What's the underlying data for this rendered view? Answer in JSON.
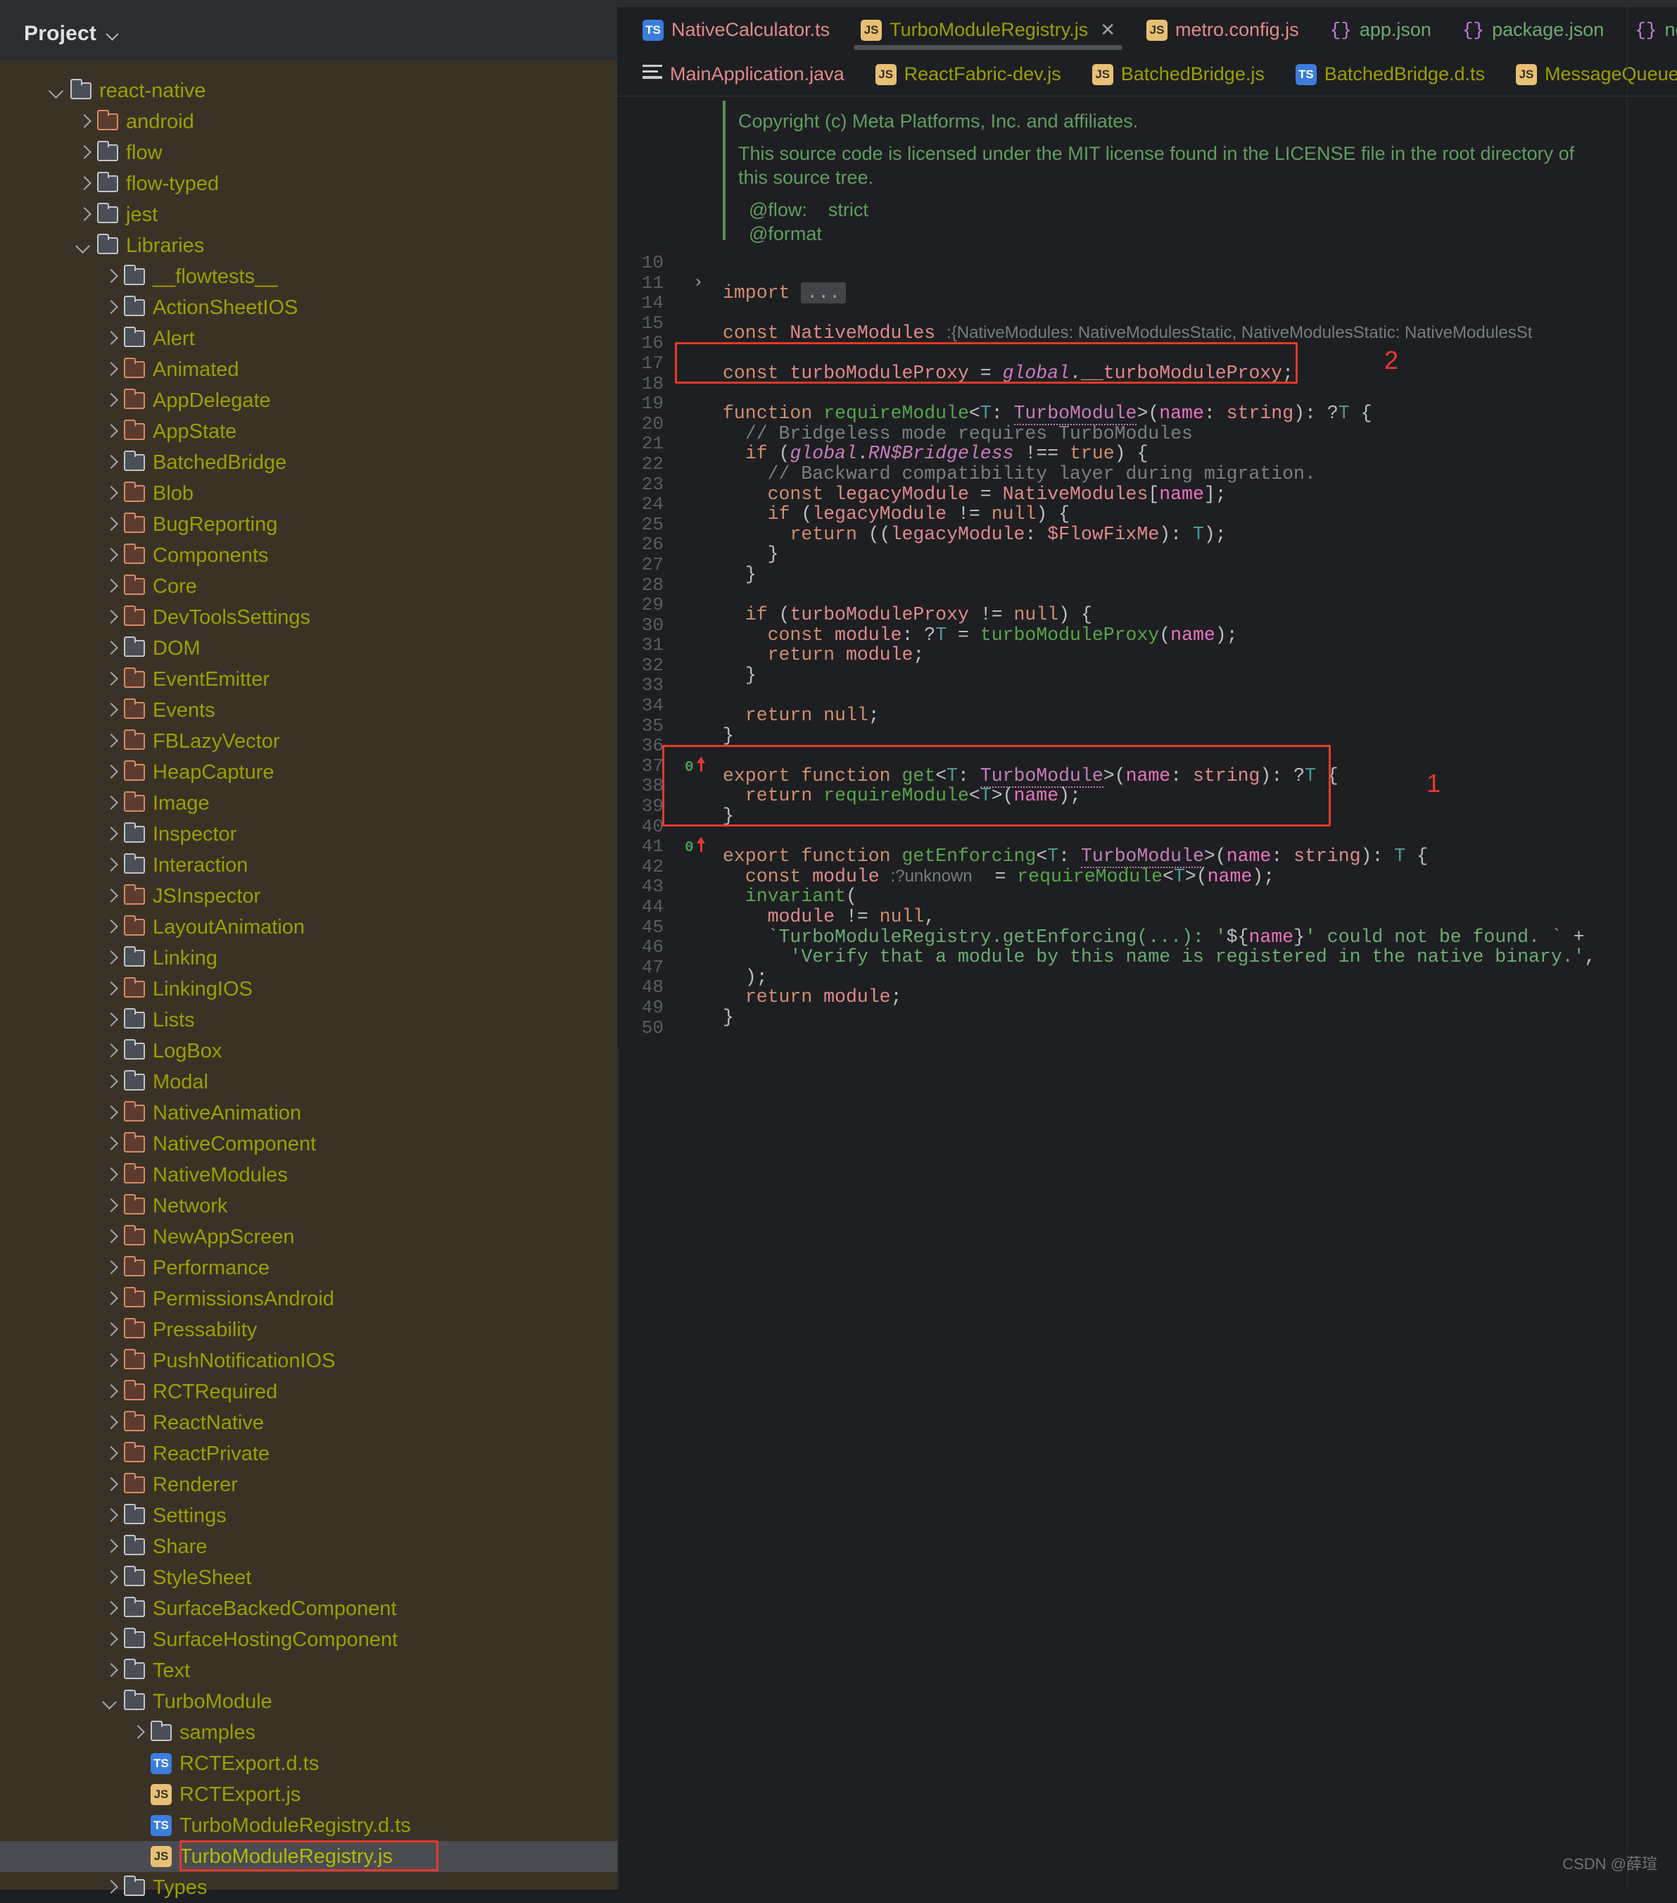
{
  "app": {
    "sidebar_title": "Project",
    "watermark": "CSDN @薛瑄"
  },
  "tabs_row1": [
    {
      "label": "NativeCalculator.ts",
      "icon": "ts-badge",
      "color": "#e08a8a",
      "active": false,
      "closable": false
    },
    {
      "label": "TurboModuleRegistry.js",
      "icon": "js-badge",
      "color": "#9aa000",
      "active": true,
      "closable": true,
      "close": "✕"
    },
    {
      "label": "metro.config.js",
      "icon": "js-badge",
      "color": "#e08a8a",
      "active": false,
      "closable": false
    },
    {
      "label": "app.json",
      "icon": "json-braces",
      "color": "#6aab73",
      "active": false,
      "closable": false
    },
    {
      "label": "package.json",
      "icon": "json-braces",
      "color": "#6aab73",
      "active": false,
      "closable": false
    },
    {
      "label": "node_m",
      "icon": "json-braces",
      "color": "#6aab73",
      "active": false,
      "closable": false
    }
  ],
  "tabs_row2": [
    {
      "label": "MainApplication.java",
      "icon": "java-lines",
      "color": "#e08a8a"
    },
    {
      "label": "ReactFabric-dev.js",
      "icon": "js-badge",
      "color": "#9aa000"
    },
    {
      "label": "BatchedBridge.js",
      "icon": "js-badge",
      "color": "#9aa000"
    },
    {
      "label": "BatchedBridge.d.ts",
      "icon": "ts-badge",
      "color": "#9aa000"
    },
    {
      "label": "MessageQueue.js",
      "icon": "js-badge",
      "color": "#9aa000"
    }
  ],
  "tree": [
    {
      "label": "react-native",
      "type": "folder",
      "indent": 1,
      "state": "open",
      "mod": false
    },
    {
      "label": "android",
      "type": "folder",
      "indent": 2,
      "state": "closed",
      "mod": true
    },
    {
      "label": "flow",
      "type": "folder",
      "indent": 2,
      "state": "closed",
      "mod": false
    },
    {
      "label": "flow-typed",
      "type": "folder",
      "indent": 2,
      "state": "closed",
      "mod": false
    },
    {
      "label": "jest",
      "type": "folder",
      "indent": 2,
      "state": "closed",
      "mod": false
    },
    {
      "label": "Libraries",
      "type": "folder",
      "indent": 2,
      "state": "open",
      "mod": false
    },
    {
      "label": "__flowtests__",
      "type": "folder",
      "indent": 3,
      "state": "closed",
      "mod": false
    },
    {
      "label": "ActionSheetIOS",
      "type": "folder",
      "indent": 3,
      "state": "closed",
      "mod": false
    },
    {
      "label": "Alert",
      "type": "folder",
      "indent": 3,
      "state": "closed",
      "mod": false
    },
    {
      "label": "Animated",
      "type": "folder",
      "indent": 3,
      "state": "closed",
      "mod": true
    },
    {
      "label": "AppDelegate",
      "type": "folder",
      "indent": 3,
      "state": "closed",
      "mod": true
    },
    {
      "label": "AppState",
      "type": "folder",
      "indent": 3,
      "state": "closed",
      "mod": true
    },
    {
      "label": "BatchedBridge",
      "type": "folder",
      "indent": 3,
      "state": "closed",
      "mod": false
    },
    {
      "label": "Blob",
      "type": "folder",
      "indent": 3,
      "state": "closed",
      "mod": true
    },
    {
      "label": "BugReporting",
      "type": "folder",
      "indent": 3,
      "state": "closed",
      "mod": true
    },
    {
      "label": "Components",
      "type": "folder",
      "indent": 3,
      "state": "closed",
      "mod": true
    },
    {
      "label": "Core",
      "type": "folder",
      "indent": 3,
      "state": "closed",
      "mod": true
    },
    {
      "label": "DevToolsSettings",
      "type": "folder",
      "indent": 3,
      "state": "closed",
      "mod": true
    },
    {
      "label": "DOM",
      "type": "folder",
      "indent": 3,
      "state": "closed",
      "mod": false
    },
    {
      "label": "EventEmitter",
      "type": "folder",
      "indent": 3,
      "state": "closed",
      "mod": true
    },
    {
      "label": "Events",
      "type": "folder",
      "indent": 3,
      "state": "closed",
      "mod": true
    },
    {
      "label": "FBLazyVector",
      "type": "folder",
      "indent": 3,
      "state": "closed",
      "mod": true
    },
    {
      "label": "HeapCapture",
      "type": "folder",
      "indent": 3,
      "state": "closed",
      "mod": true
    },
    {
      "label": "Image",
      "type": "folder",
      "indent": 3,
      "state": "closed",
      "mod": true
    },
    {
      "label": "Inspector",
      "type": "folder",
      "indent": 3,
      "state": "closed",
      "mod": false
    },
    {
      "label": "Interaction",
      "type": "folder",
      "indent": 3,
      "state": "closed",
      "mod": false
    },
    {
      "label": "JSInspector",
      "type": "folder",
      "indent": 3,
      "state": "closed",
      "mod": true
    },
    {
      "label": "LayoutAnimation",
      "type": "folder",
      "indent": 3,
      "state": "closed",
      "mod": true
    },
    {
      "label": "Linking",
      "type": "folder",
      "indent": 3,
      "state": "closed",
      "mod": false
    },
    {
      "label": "LinkingIOS",
      "type": "folder",
      "indent": 3,
      "state": "closed",
      "mod": true
    },
    {
      "label": "Lists",
      "type": "folder",
      "indent": 3,
      "state": "closed",
      "mod": false
    },
    {
      "label": "LogBox",
      "type": "folder",
      "indent": 3,
      "state": "closed",
      "mod": false
    },
    {
      "label": "Modal",
      "type": "folder",
      "indent": 3,
      "state": "closed",
      "mod": false
    },
    {
      "label": "NativeAnimation",
      "type": "folder",
      "indent": 3,
      "state": "closed",
      "mod": true
    },
    {
      "label": "NativeComponent",
      "type": "folder",
      "indent": 3,
      "state": "closed",
      "mod": true
    },
    {
      "label": "NativeModules",
      "type": "folder",
      "indent": 3,
      "state": "closed",
      "mod": true
    },
    {
      "label": "Network",
      "type": "folder",
      "indent": 3,
      "state": "closed",
      "mod": true
    },
    {
      "label": "NewAppScreen",
      "type": "folder",
      "indent": 3,
      "state": "closed",
      "mod": true
    },
    {
      "label": "Performance",
      "type": "folder",
      "indent": 3,
      "state": "closed",
      "mod": true
    },
    {
      "label": "PermissionsAndroid",
      "type": "folder",
      "indent": 3,
      "state": "closed",
      "mod": true
    },
    {
      "label": "Pressability",
      "type": "folder",
      "indent": 3,
      "state": "closed",
      "mod": true
    },
    {
      "label": "PushNotificationIOS",
      "type": "folder",
      "indent": 3,
      "state": "closed",
      "mod": true
    },
    {
      "label": "RCTRequired",
      "type": "folder",
      "indent": 3,
      "state": "closed",
      "mod": true
    },
    {
      "label": "ReactNative",
      "type": "folder",
      "indent": 3,
      "state": "closed",
      "mod": true
    },
    {
      "label": "ReactPrivate",
      "type": "folder",
      "indent": 3,
      "state": "closed",
      "mod": true
    },
    {
      "label": "Renderer",
      "type": "folder",
      "indent": 3,
      "state": "closed",
      "mod": true
    },
    {
      "label": "Settings",
      "type": "folder",
      "indent": 3,
      "state": "closed",
      "mod": false
    },
    {
      "label": "Share",
      "type": "folder",
      "indent": 3,
      "state": "closed",
      "mod": false
    },
    {
      "label": "StyleSheet",
      "type": "folder",
      "indent": 3,
      "state": "closed",
      "mod": false
    },
    {
      "label": "SurfaceBackedComponent",
      "type": "folder",
      "indent": 3,
      "state": "closed",
      "mod": false
    },
    {
      "label": "SurfaceHostingComponent",
      "type": "folder",
      "indent": 3,
      "state": "closed",
      "mod": false
    },
    {
      "label": "Text",
      "type": "folder",
      "indent": 3,
      "state": "closed",
      "mod": false
    },
    {
      "label": "TurboModule",
      "type": "folder",
      "indent": 3,
      "state": "open",
      "mod": false
    },
    {
      "label": "samples",
      "type": "folder",
      "indent": 4,
      "state": "closed",
      "mod": false
    },
    {
      "label": "RCTExport.d.ts",
      "type": "file",
      "indent": 4,
      "icon": "ts",
      "state": "none"
    },
    {
      "label": "RCTExport.js",
      "type": "file",
      "indent": 4,
      "icon": "js",
      "state": "none"
    },
    {
      "label": "TurboModuleRegistry.d.ts",
      "type": "file",
      "indent": 4,
      "icon": "ts",
      "state": "none"
    },
    {
      "label": "TurboModuleRegistry.js",
      "type": "file",
      "indent": 4,
      "icon": "js",
      "state": "none",
      "selected": true,
      "boxed": true
    },
    {
      "label": "Types",
      "type": "folder",
      "indent": 3,
      "state": "closed",
      "mod": false
    }
  ],
  "doc_comment": [
    "Copyright (c) Meta Platforms, Inc. and affiliates.",
    "This source code is licensed under the MIT license found in the LICENSE file in the root directory of",
    "this source tree.",
    "@flow:    strict",
    "@format"
  ],
  "line_numbers": [
    "10",
    "11",
    "14",
    "15",
    "16",
    "17",
    "18",
    "19",
    "20",
    "21",
    "22",
    "23",
    "24",
    "25",
    "26",
    "27",
    "28",
    "29",
    "30",
    "31",
    "32",
    "33",
    "34",
    "35",
    "36",
    "37",
    "38",
    "39",
    "40",
    "41",
    "42",
    "43",
    "44",
    "45",
    "46",
    "47",
    "48",
    "49",
    "50"
  ],
  "code_lines": [
    {
      "n": "10",
      "text": ""
    },
    {
      "n": "11",
      "text": "import ...",
      "folded": true
    },
    {
      "n": "14",
      "text": ""
    },
    {
      "n": "15",
      "text": "const NativeModules :{NativeModules: NativeModulesStatic, NativeModulesStatic: NativeModulesSt"
    },
    {
      "n": "16",
      "text": ""
    },
    {
      "n": "17",
      "text": "const turboModuleProxy = global.__turboModuleProxy;"
    },
    {
      "n": "18",
      "text": ""
    },
    {
      "n": "19",
      "text": "function requireModule<T: TurboModule>(name: string): ?T {"
    },
    {
      "n": "20",
      "text": "  // Bridgeless mode requires TurboModules"
    },
    {
      "n": "21",
      "text": "  if (global.RN$Bridgeless !== true) {"
    },
    {
      "n": "22",
      "text": "    // Backward compatibility layer during migration."
    },
    {
      "n": "23",
      "text": "    const legacyModule = NativeModules[name];"
    },
    {
      "n": "24",
      "text": "    if (legacyModule != null) {"
    },
    {
      "n": "25",
      "text": "      return ((legacyModule: $FlowFixMe): T);"
    },
    {
      "n": "26",
      "text": "    }"
    },
    {
      "n": "27",
      "text": "  }"
    },
    {
      "n": "28",
      "text": ""
    },
    {
      "n": "29",
      "text": "  if (turboModuleProxy != null) {"
    },
    {
      "n": "30",
      "text": "    const module: ?T = turboModuleProxy(name);"
    },
    {
      "n": "31",
      "text": "    return module;"
    },
    {
      "n": "32",
      "text": "  }"
    },
    {
      "n": "33",
      "text": ""
    },
    {
      "n": "34",
      "text": "  return null;"
    },
    {
      "n": "35",
      "text": "}"
    },
    {
      "n": "36",
      "text": ""
    },
    {
      "n": "37",
      "text": "export function get<T: TurboModule>(name: string): ?T {",
      "marker": true
    },
    {
      "n": "38",
      "text": "  return requireModule<T>(name);"
    },
    {
      "n": "39",
      "text": "}"
    },
    {
      "n": "40",
      "text": ""
    },
    {
      "n": "41",
      "text": "export function getEnforcing<T: TurboModule>(name: string): T {",
      "marker": true
    },
    {
      "n": "42",
      "text": "  const module :?unknown  = requireModule<T>(name);"
    },
    {
      "n": "43",
      "text": "  invariant("
    },
    {
      "n": "44",
      "text": "    module != null,"
    },
    {
      "n": "45",
      "text": "    `TurboModuleRegistry.getEnforcing(...): '${name}' could not be found. ` +"
    },
    {
      "n": "46",
      "text": "      'Verify that a module by this name is registered in the native binary.',"
    },
    {
      "n": "47",
      "text": "  );"
    },
    {
      "n": "48",
      "text": "  return module;"
    },
    {
      "n": "49",
      "text": "}"
    },
    {
      "n": "50",
      "text": ""
    }
  ],
  "annotations": [
    {
      "label": "2",
      "target_line": "17"
    },
    {
      "label": "1",
      "target_lines": "37-39"
    }
  ],
  "gutter_markers": {
    "zero": "0"
  },
  "colors": {
    "annotation_red": "#e8392a",
    "sidebar_bg": "#3b3227",
    "editor_bg": "#1e1f22",
    "tab_bg": "#1e1f22",
    "selection": "#4a4c51",
    "tree_text": "#9aa000"
  }
}
